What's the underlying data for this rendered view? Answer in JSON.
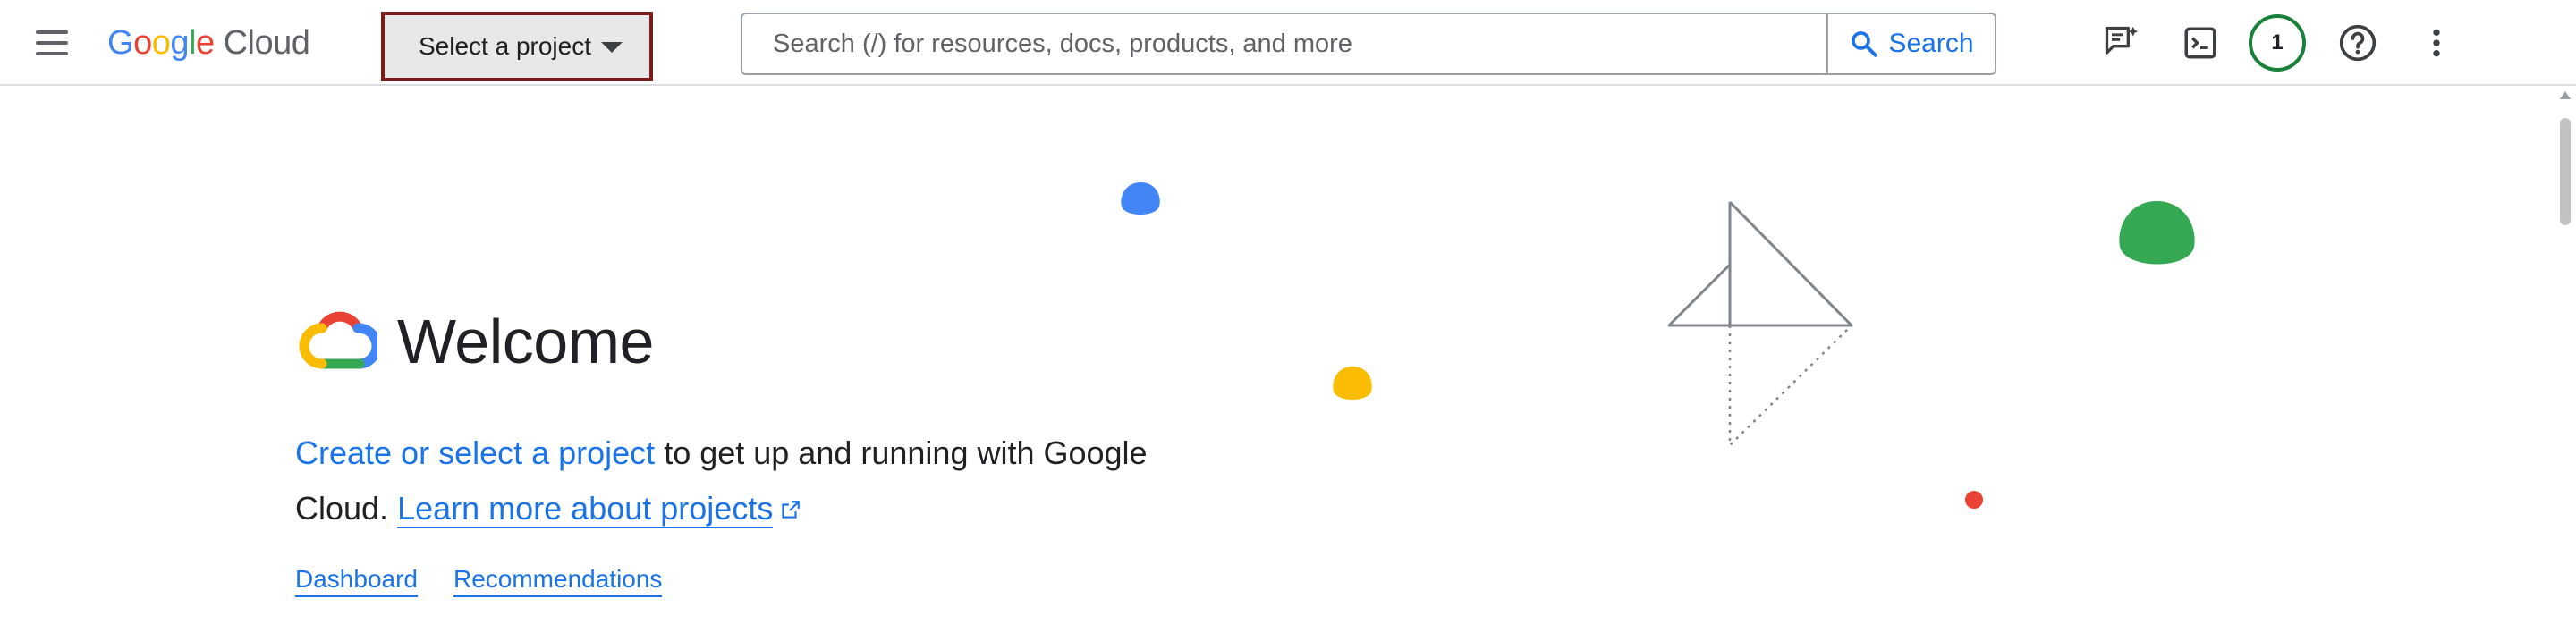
{
  "header": {
    "logo_google": [
      "G",
      "o",
      "o",
      "g",
      "l",
      "e"
    ],
    "logo_cloud": "Cloud",
    "project_selector_label": "Select a project",
    "search": {
      "placeholder": "Search (/) for resources, docs, products, and more",
      "button_label": "Search"
    },
    "notifications_count": "1",
    "icons": [
      "menu-icon",
      "gemini-chat-icon",
      "cloud-shell-icon",
      "help-icon",
      "more-vert-icon"
    ]
  },
  "main": {
    "welcome_title": "Welcome",
    "intro": {
      "create_link": "Create or select a project",
      "text_part": " to get up and running with Google Cloud. ",
      "learn_more_link": "Learn more about projects"
    },
    "quick_links": [
      "Dashboard",
      "Recommendations"
    ]
  },
  "colors": {
    "brand_blue": "#4285f4",
    "brand_red": "#ea4335",
    "brand_yellow": "#fbbc04",
    "brand_green": "#34a853",
    "link_blue": "#1a73e8",
    "project_button_border": "#7a1c1c"
  }
}
